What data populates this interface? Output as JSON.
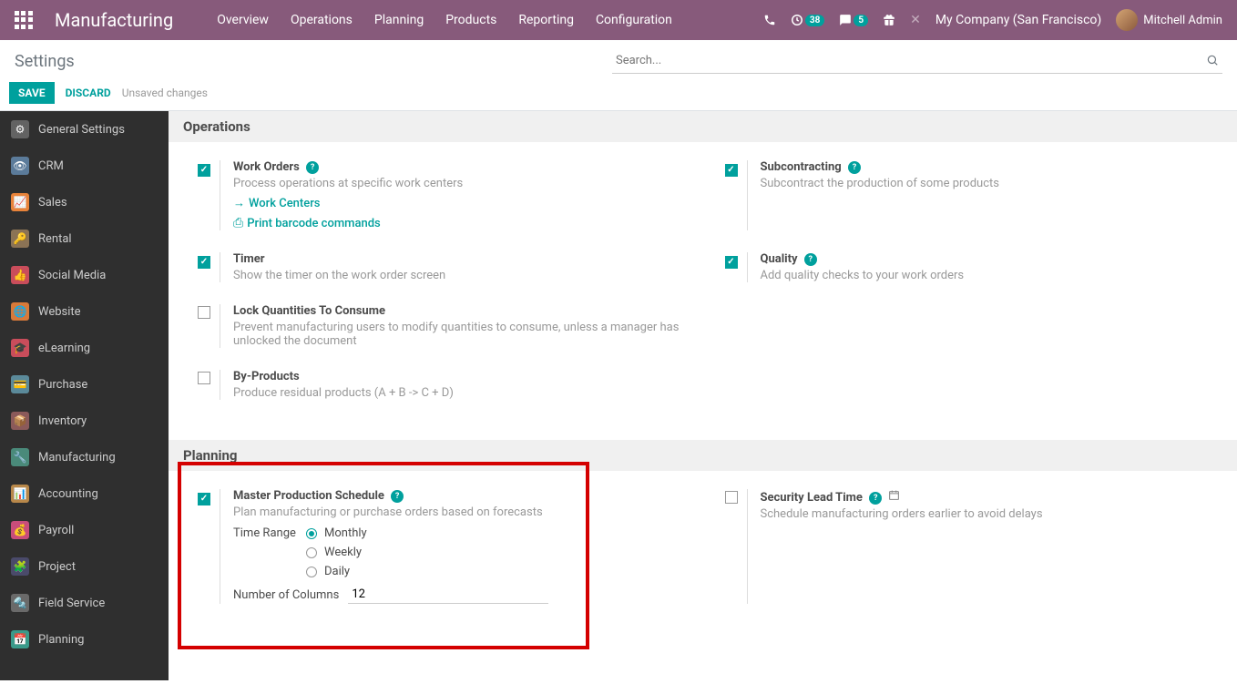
{
  "navbar": {
    "brand": "Manufacturing",
    "menu": [
      "Overview",
      "Operations",
      "Planning",
      "Products",
      "Reporting",
      "Configuration"
    ],
    "badge_activity": "38",
    "badge_chat": "5",
    "company": "My Company (San Francisco)",
    "user": "Mitchell Admin"
  },
  "page": {
    "title": "Settings",
    "search_placeholder": "Search...",
    "save": "SAVE",
    "discard": "DISCARD",
    "unsaved": "Unsaved changes"
  },
  "sidebar": [
    {
      "label": "General Settings",
      "cls": "icon-gear",
      "glyph": "⚙"
    },
    {
      "label": "CRM",
      "cls": "icon-crm",
      "glyph": "👁"
    },
    {
      "label": "Sales",
      "cls": "icon-sales",
      "glyph": "📈"
    },
    {
      "label": "Rental",
      "cls": "icon-rental",
      "glyph": "🔑"
    },
    {
      "label": "Social Media",
      "cls": "icon-social",
      "glyph": "👍"
    },
    {
      "label": "Website",
      "cls": "icon-website",
      "glyph": "🌐"
    },
    {
      "label": "eLearning",
      "cls": "icon-elearning",
      "glyph": "🎓"
    },
    {
      "label": "Purchase",
      "cls": "icon-purchase",
      "glyph": "💳"
    },
    {
      "label": "Inventory",
      "cls": "icon-inventory",
      "glyph": "📦"
    },
    {
      "label": "Manufacturing",
      "cls": "icon-manufacturing",
      "glyph": "🔧"
    },
    {
      "label": "Accounting",
      "cls": "icon-accounting",
      "glyph": "📊"
    },
    {
      "label": "Payroll",
      "cls": "icon-payroll",
      "glyph": "💰"
    },
    {
      "label": "Project",
      "cls": "icon-project",
      "glyph": "🧩"
    },
    {
      "label": "Field Service",
      "cls": "icon-fieldservice",
      "glyph": "🔩"
    },
    {
      "label": "Planning",
      "cls": "icon-planning",
      "glyph": "📅"
    }
  ],
  "sections": {
    "operations": {
      "title": "Operations",
      "work_orders": {
        "label": "Work Orders",
        "desc": "Process operations at specific work centers",
        "link1": "Work Centers",
        "link2": "Print barcode commands"
      },
      "subcontracting": {
        "label": "Subcontracting",
        "desc": "Subcontract the production of some products"
      },
      "timer": {
        "label": "Timer",
        "desc": "Show the timer on the work order screen"
      },
      "quality": {
        "label": "Quality",
        "desc": "Add quality checks to your work orders"
      },
      "lock_qty": {
        "label": "Lock Quantities To Consume",
        "desc": "Prevent manufacturing users to modify quantities to consume, unless a manager has unlocked the document"
      },
      "byproducts": {
        "label": "By-Products",
        "desc": "Produce residual products (A + B -> C + D)"
      }
    },
    "planning": {
      "title": "Planning",
      "mps": {
        "label": "Master Production Schedule",
        "desc": "Plan manufacturing or purchase orders based on forecasts",
        "time_range_label": "Time Range",
        "options": [
          "Monthly",
          "Weekly",
          "Daily"
        ],
        "num_cols_label": "Number of Columns",
        "num_cols_value": "12"
      },
      "security": {
        "label": "Security Lead Time",
        "desc": "Schedule manufacturing orders earlier to avoid delays"
      }
    }
  }
}
